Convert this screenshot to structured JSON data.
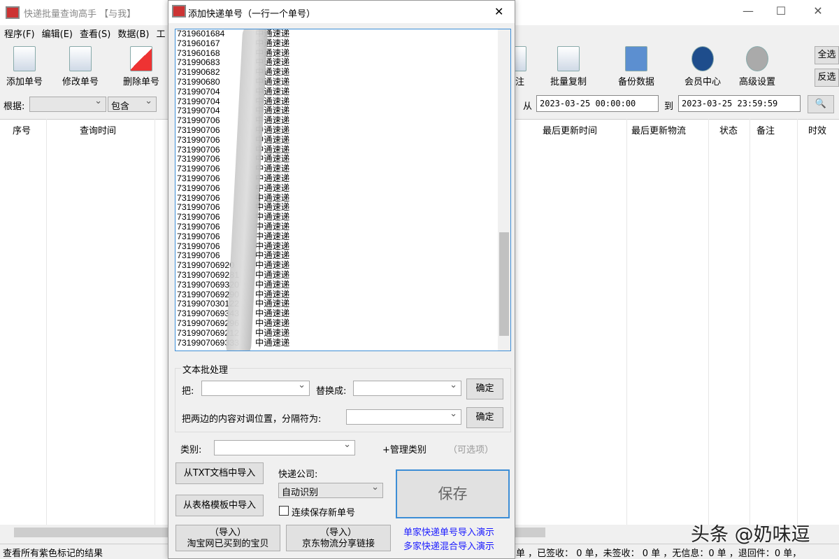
{
  "main": {
    "title": "快递批量查询高手 【与我】",
    "window_controls": [
      "—",
      "☐",
      "✕"
    ],
    "menu": [
      "程序(F)",
      "编辑(E)",
      "查看(S)",
      "数据(B)",
      "工"
    ],
    "toolbar": [
      "添加单号",
      "修改单号",
      "删除单号",
      "备注",
      "批量复制",
      "备份数据",
      "会员中心",
      "高级设置"
    ],
    "select_all": "全选",
    "invert_select": "反选",
    "filter": {
      "label": "根据:",
      "field": "",
      "op": "包含",
      "from_label": "从",
      "from": "2023-03-25 00:00:00",
      "to_label": "到",
      "to": "2023-03-25 23:59:59"
    },
    "columns": [
      "序号",
      "查询时间",
      "最后更新时间",
      "最后更新物流",
      "状态",
      "备注",
      "时效"
    ],
    "status_left": "查看所有紫色标记的结果",
    "status_right": "单 ，已签收： 0 单，未签收： 0 单 ，无信息：0 单 ，退回件：0 单，",
    "watermark": "头条 @奶味逗"
  },
  "dialog": {
    "title": "添加快递单号（一行一个单号）",
    "close": "✕",
    "lines": [
      [
        "7319601684",
        "中通速递"
      ],
      [
        "731960167",
        "中通速递"
      ],
      [
        "731960168",
        "中通速递"
      ],
      [
        "731990683",
        "中通速递"
      ],
      [
        "731990682",
        "中通速递"
      ],
      [
        "731990680",
        "中通速递"
      ],
      [
        "731990704",
        "中通速递"
      ],
      [
        "731990704",
        "中通速递"
      ],
      [
        "731990704",
        "中通速递"
      ],
      [
        "731990706",
        "中通速递"
      ],
      [
        "731990706",
        "中通速递"
      ],
      [
        "731990706",
        "中通速递"
      ],
      [
        "731990706",
        "中通速递"
      ],
      [
        "731990706",
        "中通速递"
      ],
      [
        "731990706",
        "中通速递"
      ],
      [
        "731990706",
        "中通速递"
      ],
      [
        "731990706",
        "中通速递"
      ],
      [
        "731990706",
        "中通速递"
      ],
      [
        "731990706",
        "中通速递"
      ],
      [
        "731990706",
        "中通速递"
      ],
      [
        "731990706",
        "中通速递"
      ],
      [
        "731990706",
        "中通速递"
      ],
      [
        "731990706",
        "中通速递"
      ],
      [
        "731990706",
        "中通速递"
      ],
      [
        "731990706920",
        "中通速递"
      ],
      [
        "7319907069281",
        "中通速递"
      ],
      [
        "7319907069320",
        "中通速递"
      ],
      [
        "7319907069290",
        "中通速递"
      ],
      [
        "7319907030122",
        "中通速递"
      ],
      [
        "7319907069343",
        "中通速递"
      ],
      [
        "7319907069296",
        "中通速递"
      ],
      [
        "7319907069212",
        "中通速递"
      ],
      [
        "7319907069333",
        "中通速递"
      ]
    ],
    "batch_title": "文本批处理",
    "from_label": "把:",
    "replace_label": "替换成:",
    "confirm": "确定",
    "swap_label": "把两边的内容对调位置，分隔符为:",
    "category_label": "类别:",
    "manage_category": "+管理类别",
    "optional": "（可选项）",
    "import_txt": "从TXT文档中导入",
    "import_table": "从表格模板中导入",
    "company_label": "快递公司:",
    "company": "自动识别",
    "continuous_save": "连续保存新单号",
    "save": "保存",
    "import_taobao": [
      "（导入）",
      "淘宝网已买到的宝贝"
    ],
    "import_jd": [
      "（导入）",
      "京东物流分享链接"
    ],
    "demo_single": "单家快递单号导入演示",
    "demo_multi": "多家快递混合导入演示"
  }
}
